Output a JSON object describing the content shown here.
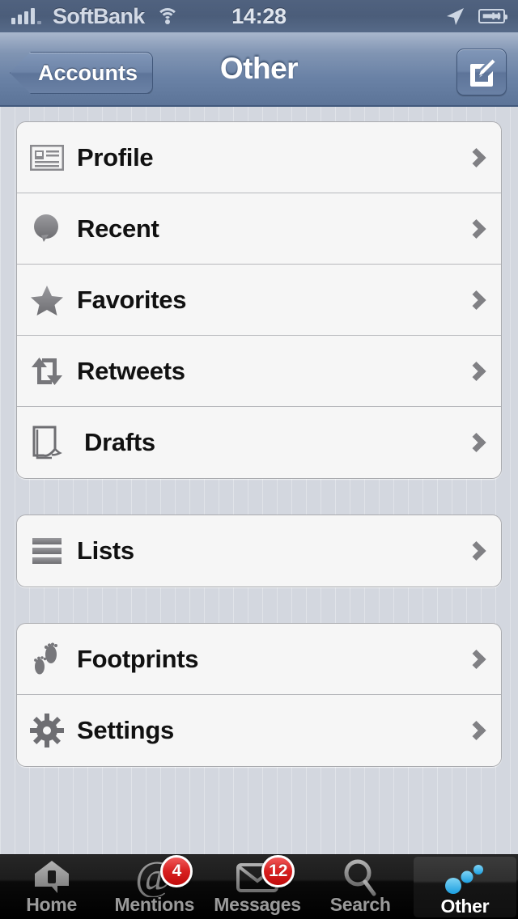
{
  "status_bar": {
    "carrier": "SoftBank",
    "time": "14:28",
    "signal_icon": "signal-bars-icon",
    "wifi_icon": "wifi-icon",
    "location_icon": "location-arrow-icon",
    "battery_icon": "battery-charging-icon",
    "signal_bars": 4
  },
  "nav_bar": {
    "back_label": "Accounts",
    "title": "Other",
    "compose_icon": "compose-icon"
  },
  "sections": [
    {
      "name": "primary",
      "rows": [
        {
          "label": "Profile",
          "icon": "id-card-icon",
          "accessory": "chevron-right-icon"
        },
        {
          "label": "Recent",
          "icon": "speech-bubble-icon",
          "accessory": "chevron-right-icon"
        },
        {
          "label": "Favorites",
          "icon": "star-icon",
          "accessory": "chevron-right-icon"
        },
        {
          "label": "Retweets",
          "icon": "retweet-icon",
          "accessory": "chevron-right-icon"
        },
        {
          "label": "Drafts",
          "icon": "draft-page-icon",
          "accessory": "chevron-right-icon"
        }
      ]
    },
    {
      "name": "lists",
      "rows": [
        {
          "label": "Lists",
          "icon": "list-lines-icon",
          "accessory": "chevron-right-icon"
        }
      ]
    },
    {
      "name": "tools",
      "rows": [
        {
          "label": "Footprints",
          "icon": "footprints-icon",
          "accessory": "chevron-right-icon"
        },
        {
          "label": "Settings",
          "icon": "gear-icon",
          "accessory": "chevron-right-icon"
        }
      ]
    }
  ],
  "tab_bar": {
    "tabs": [
      {
        "label": "Home",
        "icon": "home-icon",
        "badge": "",
        "selected": false
      },
      {
        "label": "Mentions",
        "icon": "at-sign-icon",
        "badge": "4",
        "selected": false
      },
      {
        "label": "Messages",
        "icon": "envelope-icon",
        "badge": "12",
        "selected": false
      },
      {
        "label": "Search",
        "icon": "search-icon",
        "badge": "",
        "selected": false
      },
      {
        "label": "Other",
        "icon": "dots-icon",
        "badge": "",
        "selected": true
      }
    ]
  },
  "colors": {
    "navbar_blue": "#6a82a6",
    "badge_red": "#d81f1f",
    "accent_blue": "#3aade0",
    "background": "#d3d7df",
    "card": "#f6f6f6"
  }
}
